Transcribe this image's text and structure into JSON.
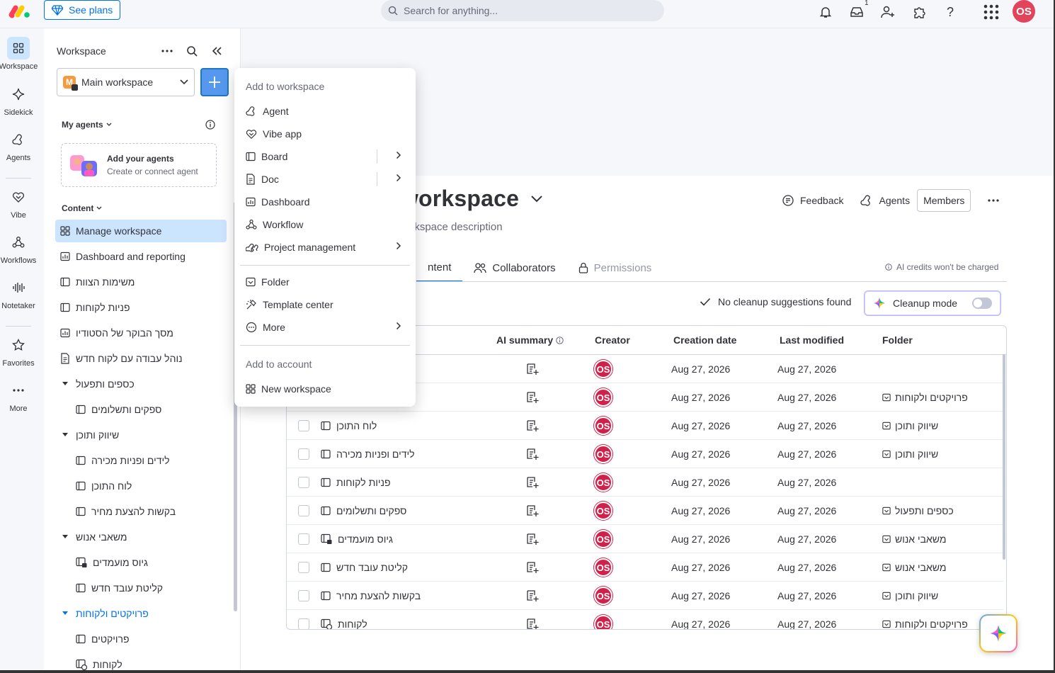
{
  "topbar": {
    "see_plans": "See plans",
    "search_placeholder": "Search for anything...",
    "inbox_badge": "1",
    "avatar_initials": "OS"
  },
  "rail": {
    "items": [
      {
        "label": "Workspace",
        "icon": "grid-icon"
      },
      {
        "label": "Sidekick",
        "icon": "sparkle-icon"
      },
      {
        "label": "Agents",
        "icon": "agent-icon"
      },
      {
        "label": "Vibe",
        "icon": "vibe-heart-icon"
      },
      {
        "label": "Workflows",
        "icon": "workflow-icon"
      },
      {
        "label": "Notetaker",
        "icon": "waveform-icon"
      },
      {
        "label": "Favorites",
        "icon": "star-icon"
      },
      {
        "label": "More",
        "icon": "dots-icon"
      }
    ]
  },
  "sidebar": {
    "title": "Workspace",
    "workspace_name": "Main workspace",
    "workspace_letter": "M",
    "my_agents": "My agents",
    "agent_card_title": "Add your agents",
    "agent_card_sub": "Create or connect agent",
    "content_label": "Content",
    "tree": [
      {
        "label": "Manage workspace",
        "icon": "manage-icon",
        "level": 0,
        "active": true
      },
      {
        "label": "Dashboard and reporting",
        "icon": "dashboard-icon",
        "level": 0
      },
      {
        "label": "משימות הצוות",
        "icon": "board-icon",
        "level": 0
      },
      {
        "label": "פניות לקוחות",
        "icon": "board-icon",
        "level": 0
      },
      {
        "label": "מסך הבוקר של הסטודיו",
        "icon": "dashboard-icon",
        "level": 0
      },
      {
        "label": "נוהל עבודה עם לקוח חדש",
        "icon": "doc-icon",
        "level": 0
      },
      {
        "label": "כספים ותפעול",
        "icon": "caret-down-icon",
        "level": 0,
        "folder": true
      },
      {
        "label": "ספקים ותשלומים",
        "icon": "board-icon",
        "level": 1
      },
      {
        "label": "שיווק ותוכן",
        "icon": "caret-down-icon",
        "level": 0,
        "folder": true
      },
      {
        "label": "לידים ופניות מכירה",
        "icon": "board-icon",
        "level": 1
      },
      {
        "label": "לוח התוכן",
        "icon": "board-icon",
        "level": 1
      },
      {
        "label": "בקשות להצעת מחיר",
        "icon": "board-icon",
        "level": 1
      },
      {
        "label": "משאבי אנוש",
        "icon": "caret-down-icon",
        "level": 0,
        "folder": true
      },
      {
        "label": "גיוס מועמדים",
        "icon": "private-board-icon",
        "level": 1
      },
      {
        "label": "קליטת עובד חדש",
        "icon": "board-icon",
        "level": 1
      },
      {
        "label": "פרויקטים ולקוחות",
        "icon": "caret-down-icon",
        "level": 0,
        "folder": true,
        "blue": true
      },
      {
        "label": "פרויקטים",
        "icon": "board-icon",
        "level": 1
      },
      {
        "label": "לקוחות",
        "icon": "shared-board-icon",
        "level": 1
      }
    ]
  },
  "menu": {
    "head1": "Add to workspace",
    "items1": [
      {
        "label": "Agent",
        "icon": "agent-icon"
      },
      {
        "label": "Vibe app",
        "icon": "vibe-heart-icon"
      },
      {
        "label": "Board",
        "icon": "board-icon",
        "arrow": true,
        "split": true
      },
      {
        "label": "Doc",
        "icon": "doc-icon",
        "arrow": true,
        "split": true
      },
      {
        "label": "Dashboard",
        "icon": "dashboard-icon"
      },
      {
        "label": "Workflow",
        "icon": "workflow-icon"
      },
      {
        "label": "Project management",
        "icon": "project-icon",
        "arrow": true
      }
    ],
    "items2": [
      {
        "label": "Folder",
        "icon": "folder-icon"
      },
      {
        "label": "Template center",
        "icon": "template-icon"
      },
      {
        "label": "More",
        "icon": "more-circle-icon",
        "arrow": true
      }
    ],
    "head2": "Add to account",
    "items3": [
      {
        "label": "New workspace",
        "icon": "grid-icon"
      }
    ]
  },
  "main": {
    "title_visible": "in workspace",
    "description": "orkspace description",
    "actions": {
      "feedback": "Feedback",
      "agents": "Agents",
      "members": "Members"
    },
    "tabs": [
      {
        "label": "ntent",
        "active": true
      },
      {
        "label": "Collaborators",
        "icon": "people-icon"
      },
      {
        "label": "Permissions",
        "icon": "lock-icon",
        "disabled": true
      }
    ],
    "ai_credits": "AI credits won't be charged",
    "cleanup_status": "No cleanup suggestions found",
    "cleanup_mode": "Cleanup mode",
    "cleanup_on": false
  },
  "table": {
    "headers": {
      "ai_summary": "AI summary",
      "creator": "Creator",
      "creation_date": "Creation date",
      "last_modified": "Last modified",
      "folder": "Folder"
    },
    "rows": [
      {
        "name": "",
        "icon": "",
        "creator": "OS",
        "created": "Aug 27, 2026",
        "modified": "Aug 27, 2026",
        "folder": ""
      },
      {
        "name": "",
        "icon": "",
        "creator": "OS",
        "created": "Aug 27, 2026",
        "modified": "Aug 27, 2026",
        "folder": "פרויקטים ולקוחות"
      },
      {
        "name": "לוח התוכן",
        "icon": "board-icon",
        "creator": "OS",
        "created": "Aug 27, 2026",
        "modified": "Aug 27, 2026",
        "folder": "שיווק ותוכן"
      },
      {
        "name": "לידים ופניות מכירה",
        "icon": "board-icon",
        "creator": "OS",
        "created": "Aug 27, 2026",
        "modified": "Aug 27, 2026",
        "folder": "שיווק ותוכן"
      },
      {
        "name": "פניות לקוחות",
        "icon": "board-icon",
        "creator": "OS",
        "created": "Aug 27, 2026",
        "modified": "Aug 27, 2026",
        "folder": ""
      },
      {
        "name": "ספקים ותשלומים",
        "icon": "board-icon",
        "creator": "OS",
        "created": "Aug 27, 2026",
        "modified": "Aug 27, 2026",
        "folder": "כספים ותפעול"
      },
      {
        "name": "גיוס מועמדים",
        "icon": "private-board-icon",
        "creator": "OS",
        "created": "Aug 27, 2026",
        "modified": "Aug 27, 2026",
        "folder": "משאבי אנוש"
      },
      {
        "name": "קליטת עובד חדש",
        "icon": "board-icon",
        "creator": "OS",
        "created": "Aug 27, 2026",
        "modified": "Aug 27, 2026",
        "folder": "משאבי אנוש"
      },
      {
        "name": "בקשות להצעת מחיר",
        "icon": "board-icon",
        "creator": "OS",
        "created": "Aug 27, 2026",
        "modified": "Aug 27, 2026",
        "folder": "שיווק ותוכן"
      },
      {
        "name": "לקוחות",
        "icon": "shared-board-icon",
        "creator": "OS",
        "created": "Aug 27, 2026",
        "modified": "Aug 27, 2026",
        "folder": "פרויקטים ולקוחות"
      }
    ]
  },
  "colors": {
    "primary": "#0073ea",
    "active_bg": "#cce5ff",
    "avatar": "#d0214a",
    "text": "#323338",
    "muted": "#676879"
  }
}
